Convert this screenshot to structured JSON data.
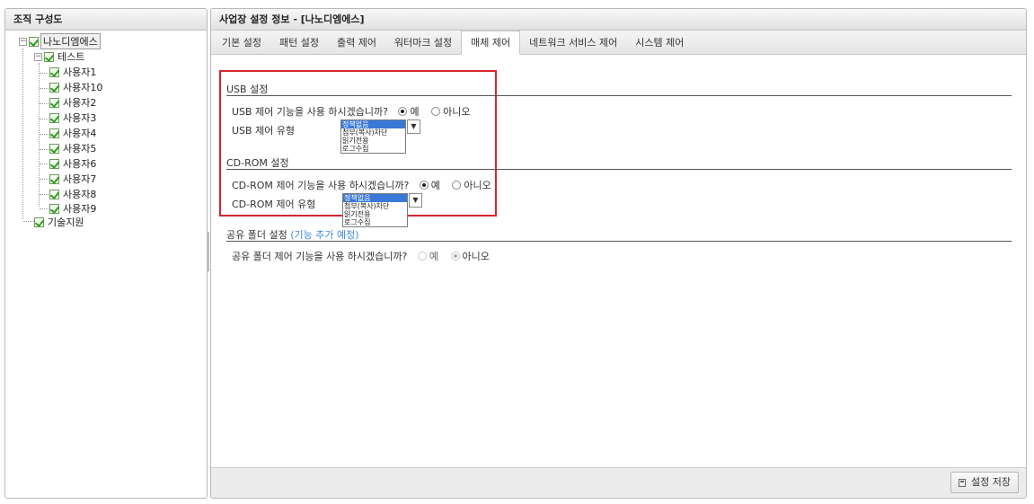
{
  "left_panel": {
    "title": "조직 구성도",
    "tree": {
      "root": {
        "label": "나노디엠에스",
        "expander": "−"
      },
      "group": {
        "label": "테스트",
        "expander": "−"
      },
      "users": [
        "사용자1",
        "사용자10",
        "사용자2",
        "사용자3",
        "사용자4",
        "사용자5",
        "사용자6",
        "사용자7",
        "사용자8",
        "사용자9"
      ],
      "last": {
        "label": "기술지원"
      }
    }
  },
  "right_panel": {
    "title": "사업장 설정 정보 - [나노디엠에스]",
    "tabs": [
      "기본 설정",
      "패턴 설정",
      "출력 제어",
      "워터마크 설정",
      "매체 제어",
      "네트워크 서비스 제어",
      "시스템 제어"
    ],
    "active_tab": "매체 제어"
  },
  "usb": {
    "title": "USB 설정",
    "question": "USB 제어 기능을 사용 하시겠습니까?",
    "yes": "예",
    "no": "아니오",
    "selected": "예",
    "type_label": "USB 제어 유형",
    "options": [
      "정책없음",
      "첨부(복사)차단",
      "읽기전용",
      "로그수집"
    ],
    "selected_option": "정책없음",
    "dropdown_arrow": "▼"
  },
  "cdrom": {
    "title": "CD-ROM 설정",
    "question": "CD-ROM 제어 기능을 사용 하시겠습니까?",
    "yes": "예",
    "no": "아니오",
    "selected": "예",
    "type_label": "CD-ROM 제어 유형",
    "options": [
      "정책없음",
      "첨부(복사)차단",
      "읽기전용",
      "로그수집"
    ],
    "selected_option": "정책없음",
    "dropdown_arrow": "▼"
  },
  "shared_folder": {
    "title": "공유 폴더 설정",
    "note": "(기능 추가 예정)",
    "question": "공유 폴더 제어 기능을 사용 하시겠습니까?",
    "yes": "예",
    "no": "아니오",
    "selected": "아니오"
  },
  "footer": {
    "save_label": "설정 저장"
  },
  "colors": {
    "highlight_border": "#d7252f",
    "note_text": "#3f86d6",
    "list_selection": "#3a78d8"
  }
}
